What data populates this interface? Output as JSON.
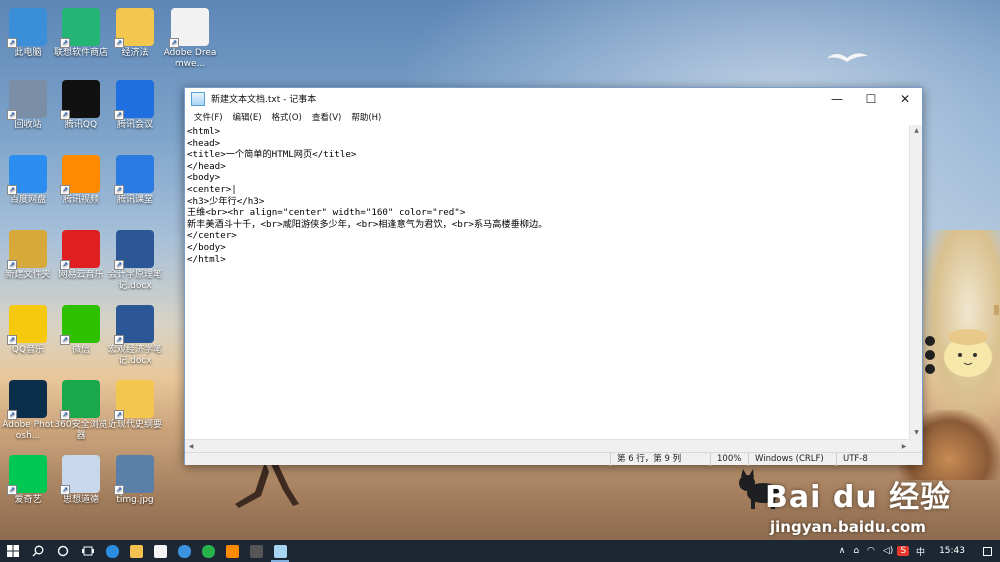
{
  "desktop": {
    "icons": [
      {
        "label": "此电脑",
        "icon": "computer-icon",
        "color": "#3b8fd8"
      },
      {
        "label": "联想软件商店",
        "icon": "lenovo-store-icon",
        "color": "#22b573"
      },
      {
        "label": "经济法",
        "icon": "document-icon",
        "color": "#f3c74e"
      },
      {
        "label": "Adobe Dreamwe...",
        "icon": "file-icon",
        "color": "#f2f2f2"
      },
      {
        "label": "回收站",
        "icon": "recycle-bin-icon",
        "color": "#7a8fa6"
      },
      {
        "label": "腾讯QQ",
        "icon": "qq-icon",
        "color": "#111111"
      },
      {
        "label": "腾讯会议",
        "icon": "tencent-meeting-icon",
        "color": "#1f6fe0"
      },
      {
        "label": "百度网盘",
        "icon": "baidu-netdisk-icon",
        "color": "#2b8df0"
      },
      {
        "label": "腾讯视频",
        "icon": "tencent-video-icon",
        "color": "#ff8a00"
      },
      {
        "label": "腾讯课堂",
        "icon": "tencent-classroom-icon",
        "color": "#2a7ae2"
      },
      {
        "label": "新建文件夹",
        "icon": "folder-icon",
        "color": "#d7a93b"
      },
      {
        "label": "网易云音乐",
        "icon": "netease-music-icon",
        "color": "#e02020"
      },
      {
        "label": "会计学原理笔记.docx",
        "icon": "word-icon",
        "color": "#2b5797"
      },
      {
        "label": "QQ音乐",
        "icon": "qq-music-icon",
        "color": "#f6c90e"
      },
      {
        "label": "微信",
        "icon": "wechat-icon",
        "color": "#2dc100"
      },
      {
        "label": "宏观经济学笔记.docx",
        "icon": "word-icon",
        "color": "#2b5797"
      },
      {
        "label": "Adobe Photosh...",
        "icon": "photoshop-icon",
        "color": "#0b2f4a"
      },
      {
        "label": "360安全浏览器",
        "icon": "browser-360-icon",
        "color": "#19a84b"
      },
      {
        "label": "近现代史纲要",
        "icon": "document-icon",
        "color": "#f3c74e"
      },
      {
        "label": "爱奇艺",
        "icon": "iqiyi-icon",
        "color": "#00c853"
      },
      {
        "label": "思想道德",
        "icon": "document-icon",
        "color": "#c7d8ec"
      },
      {
        "label": "timg.jpg",
        "icon": "image-icon",
        "color": "#5a7fa8"
      }
    ]
  },
  "notepad": {
    "title": "新建文本文档.txt - 记事本",
    "menu": [
      "文件(F)",
      "编辑(E)",
      "格式(O)",
      "查看(V)",
      "帮助(H)"
    ],
    "content": "<html>\n<head>\n<title>一个简单的HTML网页</title>\n</head>\n<body>\n<center>|\n<h3>少年行</h3>\n王维<br><hr align=\"center\" width=\"160\" color=\"red\">\n新丰美酒斗十千，<br>咸阳游侠多少年，<br>相逢意气为君饮，<br>系马高楼垂柳边。\n</center>\n</body>\n</html>",
    "status": {
      "position": "第 6 行，第 9 列",
      "zoom": "100%",
      "line_ending": "Windows (CRLF)",
      "encoding": "UTF-8"
    },
    "buttons": {
      "minimize": "—",
      "maximize": "☐",
      "close": "✕"
    }
  },
  "taskbar": {
    "clock": "15:43",
    "ime": "中",
    "ime_brand": "S",
    "tray_icons": [
      "chevron-up-icon",
      "vpn-icon",
      "wifi-icon",
      "volume-icon"
    ]
  },
  "watermark": {
    "logo": "Bai du 经验",
    "url": "jingyan.baidu.com"
  }
}
